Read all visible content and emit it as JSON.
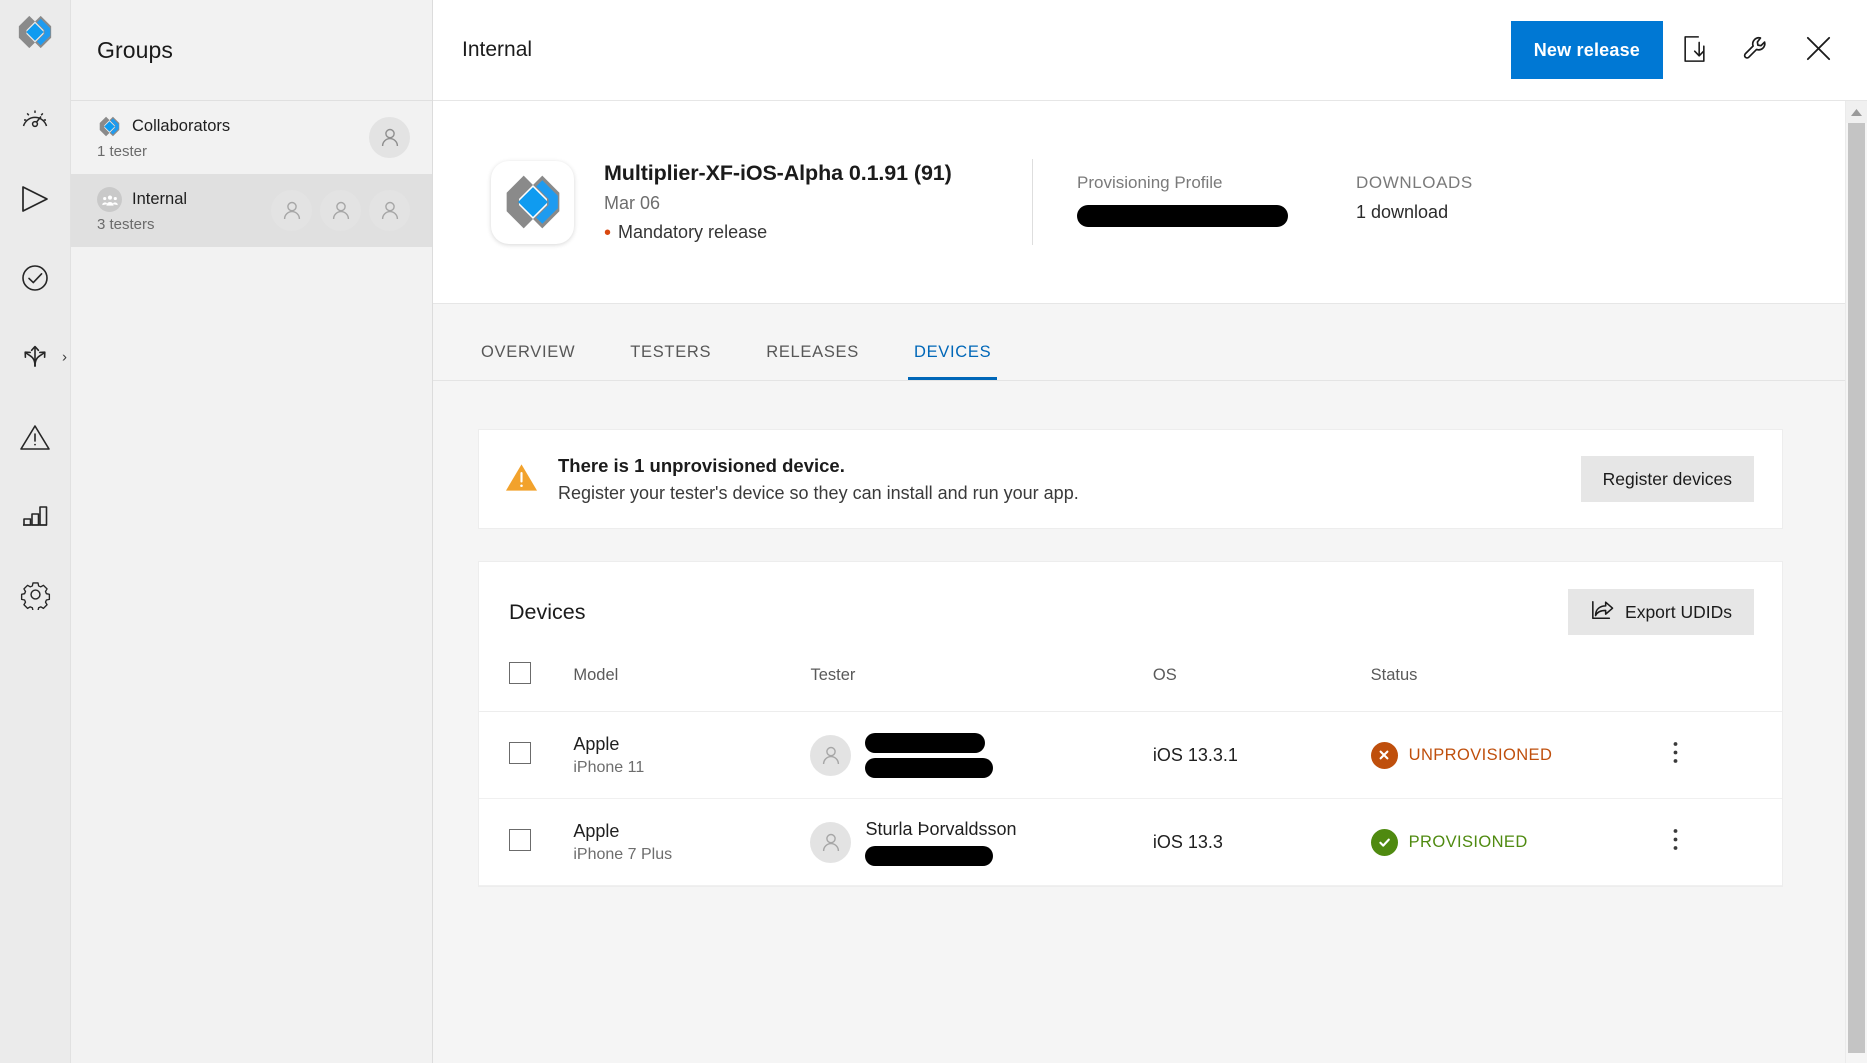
{
  "rail": {
    "logo_icon": "appcenter-logo-icon",
    "items": [
      {
        "icon": "gauge-icon",
        "name": "overview"
      },
      {
        "icon": "play-triangle-icon",
        "name": "build"
      },
      {
        "icon": "check-circle-icon",
        "name": "test"
      },
      {
        "icon": "distribute-arrows-icon",
        "name": "distribute",
        "expanded_chevron": "›"
      },
      {
        "icon": "warning-triangle-icon",
        "name": "diagnostics"
      },
      {
        "icon": "bar-chart-icon",
        "name": "analytics"
      },
      {
        "icon": "gear-icon",
        "name": "settings"
      }
    ]
  },
  "groups": {
    "title": "Groups",
    "items": [
      {
        "name": "Collaborators",
        "subtitle": "1 tester",
        "icon": "appcenter-logo-icon",
        "avatars": 1,
        "selected": false
      },
      {
        "name": "Internal",
        "subtitle": "3 testers",
        "icon": "people-icon",
        "avatars": 3,
        "selected": true
      }
    ]
  },
  "header": {
    "title": "Internal",
    "new_release_label": "New release",
    "icons": [
      {
        "name": "download-to-device-icon"
      },
      {
        "name": "wrench-icon"
      },
      {
        "name": "close-icon"
      }
    ]
  },
  "release": {
    "app_icon": "appcenter-app-icon",
    "name": "Multiplier-XF-iOS-Alpha 0.1.91 (91)",
    "date": "Mar 06",
    "mandatory_label": "Mandatory release",
    "mandatory_dot_color": "#d9480f",
    "facts": [
      {
        "label": "Provisioning Profile",
        "value": "",
        "redacted": true,
        "redacted_width": 211
      },
      {
        "label": "DOWNLOADS",
        "value": "1 download",
        "redacted": false
      }
    ]
  },
  "tabs": [
    {
      "label": "OVERVIEW",
      "active": false
    },
    {
      "label": "TESTERS",
      "active": false
    },
    {
      "label": "RELEASES",
      "active": false
    },
    {
      "label": "DEVICES",
      "active": true
    }
  ],
  "banner": {
    "icon": "warning-triangle-icon",
    "title": "There is 1 unprovisioned device.",
    "subtitle": "Register your tester's device so they can install and run your app.",
    "button_label": "Register devices"
  },
  "devices_panel": {
    "title": "Devices",
    "export_label": "Export UDIDs",
    "export_icon": "share-export-icon",
    "columns": [
      "Model",
      "Tester",
      "OS",
      "Status"
    ],
    "rows": [
      {
        "model": "Apple",
        "model_sub": "iPhone 11",
        "tester_name": "",
        "tester_redacted": true,
        "tester_redacted_width": 120,
        "os": "iOS 13.3.1",
        "status": "UNPROVISIONED",
        "status_kind": "error",
        "status_color": "#bf4f0c",
        "menu_icon": "kebab-menu-icon"
      },
      {
        "model": "Apple",
        "model_sub": "iPhone 7 Plus",
        "tester_name": "Sturla Þorvaldsson",
        "tester_redacted": true,
        "tester_redacted_width": 128,
        "os": "iOS 13.3",
        "status": "PROVISIONED",
        "status_kind": "ok",
        "status_color": "#4f8a10",
        "menu_icon": "kebab-menu-icon"
      }
    ]
  },
  "colors": {
    "accent": "#0078d4",
    "tab_active": "#0067b8",
    "warning": "#f2a22c",
    "error": "#bf4f0c",
    "success": "#4f8a10"
  },
  "scrollbar": {
    "up_arrow": "▴"
  }
}
